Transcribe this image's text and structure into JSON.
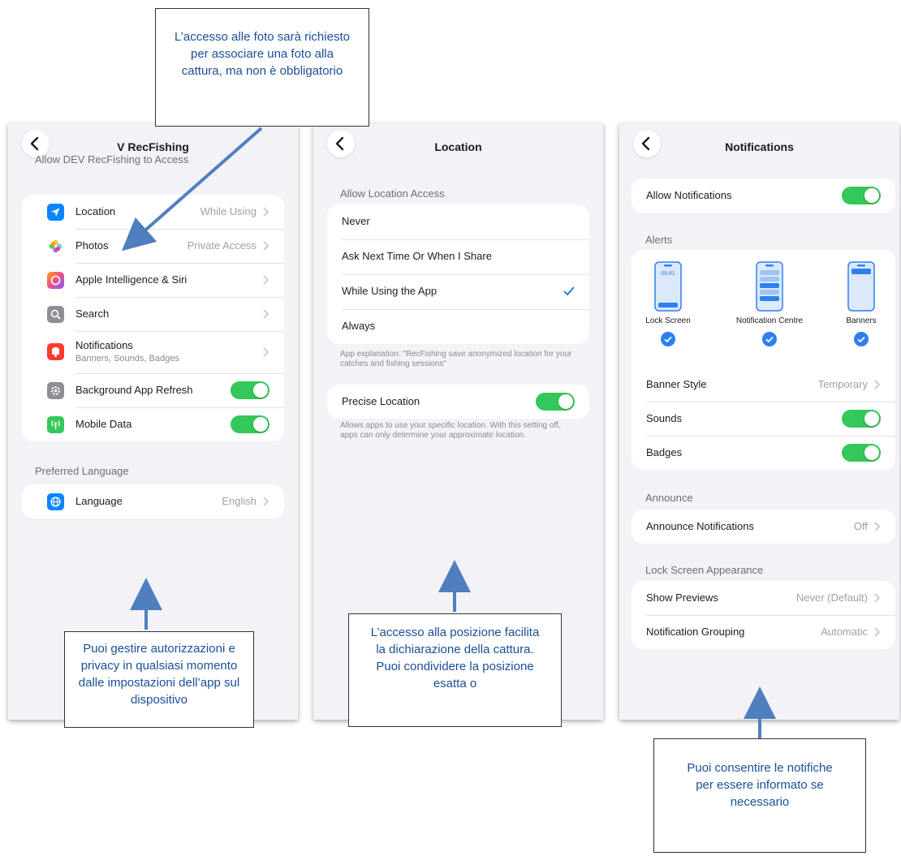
{
  "colors": {
    "accent": "#007aff",
    "toggle_on": "#34c759",
    "annotation_text": "#1a4f96",
    "arrow": "#4f7fbf"
  },
  "screen1": {
    "title": "V RecFishing",
    "access_header": "Allow DEV RecFishing to Access",
    "items": [
      {
        "label": "Location",
        "value": "While Using",
        "icon": "location-arrow-icon",
        "icon_color": "#0a84ff"
      },
      {
        "label": "Photos",
        "value": "Private Access",
        "icon": "photos-flower-icon",
        "icon_color": "#ffffff"
      },
      {
        "label": "Apple Intelligence & Siri",
        "value": "",
        "icon": "siri-icon",
        "icon_color": "#e9508a"
      },
      {
        "label": "Search",
        "value": "",
        "icon": "search-icon",
        "icon_color": "#8e8e93"
      },
      {
        "label": "Notifications",
        "sublabel": "Banners, Sounds, Badges",
        "icon": "notifications-icon",
        "icon_color": "#ff3b30"
      },
      {
        "label": "Background App Refresh",
        "toggle": true,
        "icon": "gear-icon",
        "icon_color": "#8e8e93"
      },
      {
        "label": "Mobile Data",
        "toggle": true,
        "icon": "antenna-icon",
        "icon_color": "#34c759"
      }
    ],
    "language_header": "Preferred Language",
    "language": {
      "label": "Language",
      "value": "English",
      "icon": "globe-icon",
      "icon_color": "#0a84ff"
    }
  },
  "screen2": {
    "title": "Location",
    "header": "Allow Location Access",
    "options": [
      "Never",
      "Ask Next Time Or When I Share",
      "While Using the App",
      "Always"
    ],
    "selected": "While Using the App",
    "explanation": "App explanation: \"RecFishing save anonymized location for your catches and fishing sessions\"",
    "precise_label": "Precise Location",
    "precise_on": true,
    "precise_footer": "Allows apps to use your specific location. With this setting off, apps can only determine your approximate location."
  },
  "screen3": {
    "title": "Notifications",
    "allow_label": "Allow Notifications",
    "alerts_header": "Alerts",
    "phone_time": "09:41",
    "alert_types": [
      "Lock Screen",
      "Notification Centre",
      "Banners"
    ],
    "banner_style": {
      "label": "Banner Style",
      "value": "Temporary"
    },
    "sounds_label": "Sounds",
    "badges_label": "Badges",
    "announce_header": "Announce",
    "announce": {
      "label": "Announce Notifications",
      "value": "Off"
    },
    "lock_header": "Lock Screen Appearance",
    "show_previews": {
      "label": "Show Previews",
      "value": "Never (Default)"
    },
    "grouping": {
      "label": "Notification Grouping",
      "value": "Automatic"
    }
  },
  "callouts": {
    "photos": "L’accesso alle foto sarà richiesto per associare una foto alla cattura, ma non è obbligatorio",
    "privacy": "Puoi gestire autorizzazioni e privacy in qualsiasi momento dalle impostazioni dell’app sul dispositivo",
    "location": "L’accesso alla posizione facilita la dichiarazione della cattura. Puoi condividere la posizione esatta o",
    "notifications": "Puoi consentire le notifiche per essere informato se necessario"
  }
}
